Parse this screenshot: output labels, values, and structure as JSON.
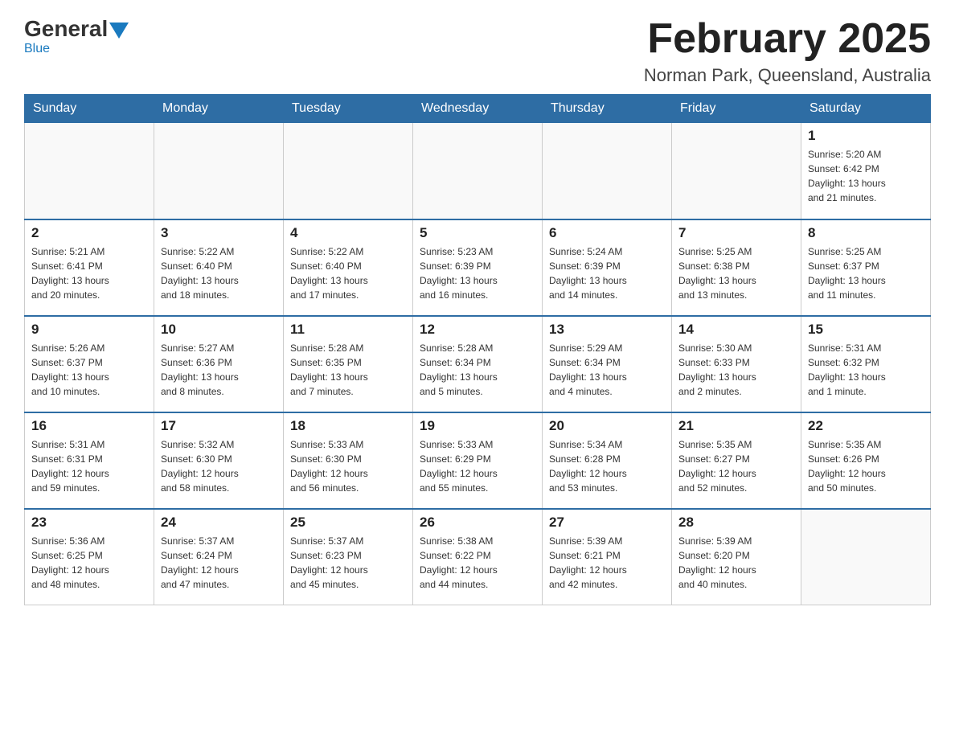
{
  "header": {
    "logo_general": "General",
    "logo_blue": "Blue",
    "month_title": "February 2025",
    "location": "Norman Park, Queensland, Australia"
  },
  "days_of_week": [
    "Sunday",
    "Monday",
    "Tuesday",
    "Wednesday",
    "Thursday",
    "Friday",
    "Saturday"
  ],
  "weeks": [
    [
      {
        "day": "",
        "info": ""
      },
      {
        "day": "",
        "info": ""
      },
      {
        "day": "",
        "info": ""
      },
      {
        "day": "",
        "info": ""
      },
      {
        "day": "",
        "info": ""
      },
      {
        "day": "",
        "info": ""
      },
      {
        "day": "1",
        "info": "Sunrise: 5:20 AM\nSunset: 6:42 PM\nDaylight: 13 hours\nand 21 minutes."
      }
    ],
    [
      {
        "day": "2",
        "info": "Sunrise: 5:21 AM\nSunset: 6:41 PM\nDaylight: 13 hours\nand 20 minutes."
      },
      {
        "day": "3",
        "info": "Sunrise: 5:22 AM\nSunset: 6:40 PM\nDaylight: 13 hours\nand 18 minutes."
      },
      {
        "day": "4",
        "info": "Sunrise: 5:22 AM\nSunset: 6:40 PM\nDaylight: 13 hours\nand 17 minutes."
      },
      {
        "day": "5",
        "info": "Sunrise: 5:23 AM\nSunset: 6:39 PM\nDaylight: 13 hours\nand 16 minutes."
      },
      {
        "day": "6",
        "info": "Sunrise: 5:24 AM\nSunset: 6:39 PM\nDaylight: 13 hours\nand 14 minutes."
      },
      {
        "day": "7",
        "info": "Sunrise: 5:25 AM\nSunset: 6:38 PM\nDaylight: 13 hours\nand 13 minutes."
      },
      {
        "day": "8",
        "info": "Sunrise: 5:25 AM\nSunset: 6:37 PM\nDaylight: 13 hours\nand 11 minutes."
      }
    ],
    [
      {
        "day": "9",
        "info": "Sunrise: 5:26 AM\nSunset: 6:37 PM\nDaylight: 13 hours\nand 10 minutes."
      },
      {
        "day": "10",
        "info": "Sunrise: 5:27 AM\nSunset: 6:36 PM\nDaylight: 13 hours\nand 8 minutes."
      },
      {
        "day": "11",
        "info": "Sunrise: 5:28 AM\nSunset: 6:35 PM\nDaylight: 13 hours\nand 7 minutes."
      },
      {
        "day": "12",
        "info": "Sunrise: 5:28 AM\nSunset: 6:34 PM\nDaylight: 13 hours\nand 5 minutes."
      },
      {
        "day": "13",
        "info": "Sunrise: 5:29 AM\nSunset: 6:34 PM\nDaylight: 13 hours\nand 4 minutes."
      },
      {
        "day": "14",
        "info": "Sunrise: 5:30 AM\nSunset: 6:33 PM\nDaylight: 13 hours\nand 2 minutes."
      },
      {
        "day": "15",
        "info": "Sunrise: 5:31 AM\nSunset: 6:32 PM\nDaylight: 13 hours\nand 1 minute."
      }
    ],
    [
      {
        "day": "16",
        "info": "Sunrise: 5:31 AM\nSunset: 6:31 PM\nDaylight: 12 hours\nand 59 minutes."
      },
      {
        "day": "17",
        "info": "Sunrise: 5:32 AM\nSunset: 6:30 PM\nDaylight: 12 hours\nand 58 minutes."
      },
      {
        "day": "18",
        "info": "Sunrise: 5:33 AM\nSunset: 6:30 PM\nDaylight: 12 hours\nand 56 minutes."
      },
      {
        "day": "19",
        "info": "Sunrise: 5:33 AM\nSunset: 6:29 PM\nDaylight: 12 hours\nand 55 minutes."
      },
      {
        "day": "20",
        "info": "Sunrise: 5:34 AM\nSunset: 6:28 PM\nDaylight: 12 hours\nand 53 minutes."
      },
      {
        "day": "21",
        "info": "Sunrise: 5:35 AM\nSunset: 6:27 PM\nDaylight: 12 hours\nand 52 minutes."
      },
      {
        "day": "22",
        "info": "Sunrise: 5:35 AM\nSunset: 6:26 PM\nDaylight: 12 hours\nand 50 minutes."
      }
    ],
    [
      {
        "day": "23",
        "info": "Sunrise: 5:36 AM\nSunset: 6:25 PM\nDaylight: 12 hours\nand 48 minutes."
      },
      {
        "day": "24",
        "info": "Sunrise: 5:37 AM\nSunset: 6:24 PM\nDaylight: 12 hours\nand 47 minutes."
      },
      {
        "day": "25",
        "info": "Sunrise: 5:37 AM\nSunset: 6:23 PM\nDaylight: 12 hours\nand 45 minutes."
      },
      {
        "day": "26",
        "info": "Sunrise: 5:38 AM\nSunset: 6:22 PM\nDaylight: 12 hours\nand 44 minutes."
      },
      {
        "day": "27",
        "info": "Sunrise: 5:39 AM\nSunset: 6:21 PM\nDaylight: 12 hours\nand 42 minutes."
      },
      {
        "day": "28",
        "info": "Sunrise: 5:39 AM\nSunset: 6:20 PM\nDaylight: 12 hours\nand 40 minutes."
      },
      {
        "day": "",
        "info": ""
      }
    ]
  ]
}
